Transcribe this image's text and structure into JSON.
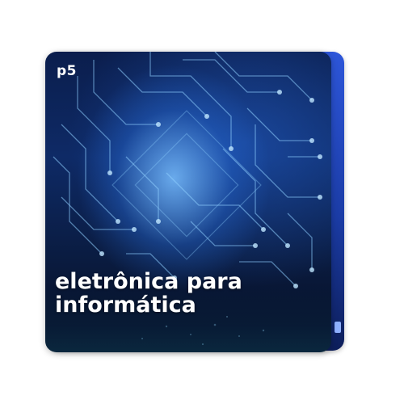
{
  "cover": {
    "brand_label": "p5",
    "title_line_1": "eletrônica para",
    "title_line_2": "informática"
  },
  "colors": {
    "card_background": "#0b1e4d",
    "glow": "#6fb6ff",
    "back_card": "#2d56d9",
    "text": "#ffffff"
  }
}
